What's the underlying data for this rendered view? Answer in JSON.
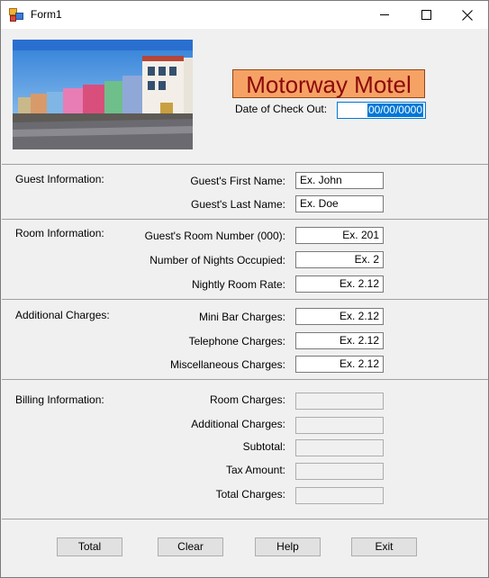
{
  "window": {
    "title": "Form1"
  },
  "header": {
    "title": "Motorway Motel",
    "checkout_label": "Date of Check Out:",
    "checkout_value": "00/00/0000"
  },
  "guest": {
    "section": "Guest Information:",
    "first_label": "Guest's First Name:",
    "first_value": "Ex. John",
    "last_label": "Guest's Last Name:",
    "last_value": "Ex. Doe"
  },
  "room": {
    "section": "Room Information:",
    "number_label": "Guest's Room Number (000):",
    "number_value": "Ex. 201",
    "nights_label": "Number of Nights Occupied:",
    "nights_value": "Ex. 2",
    "rate_label": "Nightly Room Rate:",
    "rate_value": "Ex. 2.12"
  },
  "additional": {
    "section": "Additional Charges:",
    "minibar_label": "Mini Bar Charges:",
    "minibar_value": "Ex. 2.12",
    "phone_label": "Telephone Charges:",
    "phone_value": "Ex. 2.12",
    "misc_label": "Miscellaneous Charges:",
    "misc_value": "Ex. 2.12"
  },
  "billing": {
    "section": "Billing Information:",
    "room_label": "Room Charges:",
    "additional_label": "Additional Charges:",
    "subtotal_label": "Subtotal:",
    "tax_label": "Tax Amount:",
    "total_label": "Total Charges:"
  },
  "buttons": {
    "total": "Total",
    "clear": "Clear",
    "help": "Help",
    "exit": "Exit"
  }
}
